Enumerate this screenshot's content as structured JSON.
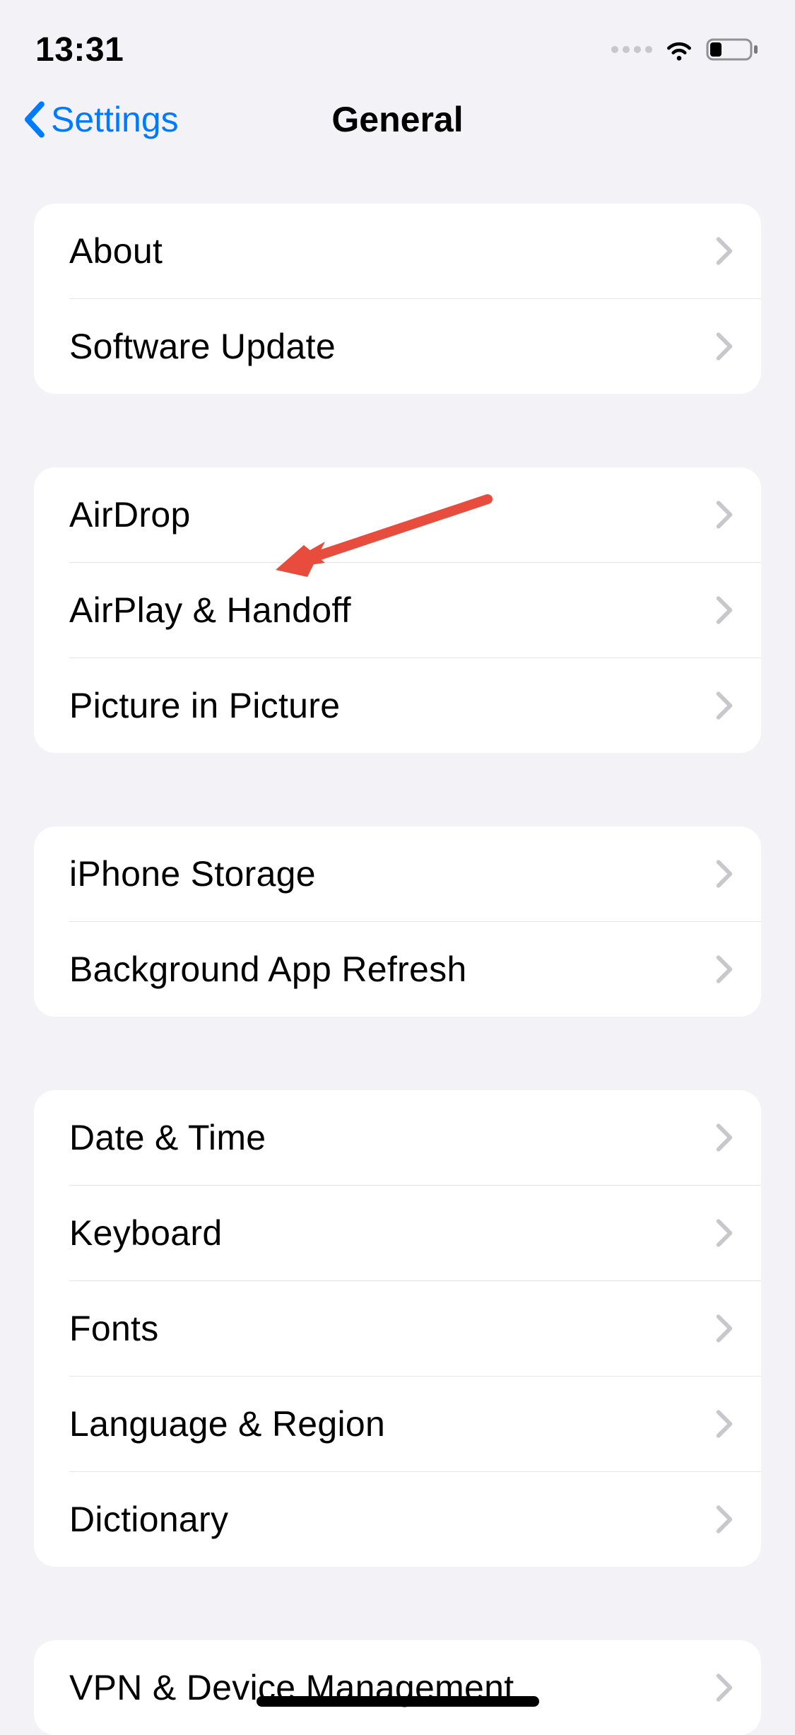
{
  "statusBar": {
    "time": "13:31"
  },
  "nav": {
    "backLabel": "Settings",
    "title": "General"
  },
  "groups": [
    {
      "rows": [
        {
          "label": "About",
          "name": "about"
        },
        {
          "label": "Software Update",
          "name": "software-update"
        }
      ]
    },
    {
      "rows": [
        {
          "label": "AirDrop",
          "name": "airdrop"
        },
        {
          "label": "AirPlay & Handoff",
          "name": "airplay-handoff"
        },
        {
          "label": "Picture in Picture",
          "name": "picture-in-picture"
        }
      ]
    },
    {
      "rows": [
        {
          "label": "iPhone Storage",
          "name": "iphone-storage"
        },
        {
          "label": "Background App Refresh",
          "name": "background-app-refresh"
        }
      ]
    },
    {
      "rows": [
        {
          "label": "Date & Time",
          "name": "date-time"
        },
        {
          "label": "Keyboard",
          "name": "keyboard"
        },
        {
          "label": "Fonts",
          "name": "fonts"
        },
        {
          "label": "Language & Region",
          "name": "language-region"
        },
        {
          "label": "Dictionary",
          "name": "dictionary"
        }
      ]
    },
    {
      "rows": [
        {
          "label": "VPN & Device Management",
          "name": "vpn-device-management"
        }
      ]
    }
  ],
  "annotation": {
    "target": "airdrop",
    "color": "#e74c3c"
  }
}
